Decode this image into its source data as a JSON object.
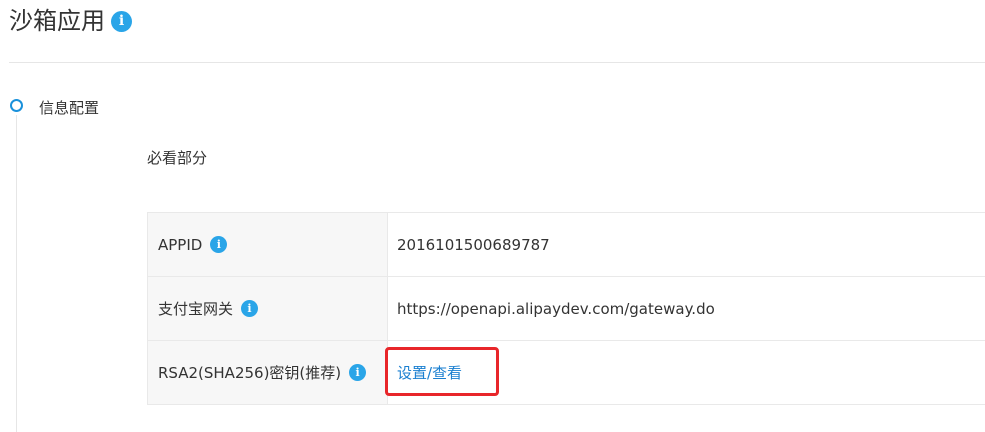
{
  "page": {
    "title": "沙箱应用",
    "title_info": "i"
  },
  "step": {
    "label": "信息配置"
  },
  "section": {
    "label": "必看部分"
  },
  "rows": [
    {
      "key": "APPID",
      "info": "i",
      "value": "2016101500689787"
    },
    {
      "key": "支付宝网关",
      "info": "i",
      "value": "https://openapi.alipaydev.com/gateway.do"
    },
    {
      "key": "RSA2(SHA256)密钥(推荐)",
      "info": "i",
      "link": "设置/查看"
    }
  ],
  "colors": {
    "accent": "#2aa5e8",
    "link": "#1a7fd0",
    "highlight": "#e8262a"
  }
}
